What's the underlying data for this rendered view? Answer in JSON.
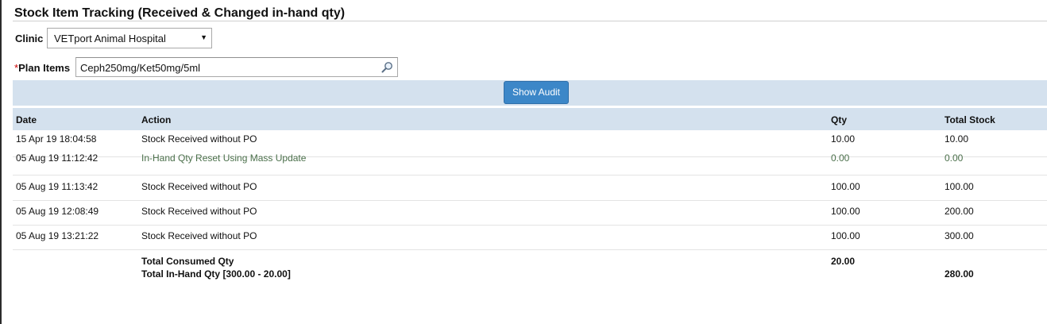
{
  "page": {
    "title": "Stock Item Tracking (Received & Changed in-hand qty)"
  },
  "filters": {
    "clinic_label": "Clinic",
    "clinic_value": "VETport Animal Hospital",
    "required_mark": "*",
    "plan_items_label": "Plan Items",
    "plan_items_value": "Ceph250mg/Ket50mg/5ml"
  },
  "actions": {
    "show_audit_label": "Show Audit"
  },
  "table": {
    "headers": {
      "date": "Date",
      "action": "Action",
      "qty": "Qty",
      "total_stock": "Total Stock"
    },
    "rows": [
      {
        "date": "15 Apr 19 18:04:58",
        "action": "Stock Received without PO",
        "qty": "10.00",
        "total": "10.00"
      },
      {
        "date": "05 Aug 19 11:12:42",
        "action": "In-Hand Qty Reset Using Mass Update",
        "qty": "0.00",
        "total": "0.00"
      },
      {
        "date": "05 Aug 19 11:13:42",
        "action": "Stock Received without PO",
        "qty": "100.00",
        "total": "100.00"
      },
      {
        "date": "05 Aug 19 12:08:49",
        "action": "Stock Received without PO",
        "qty": "100.00",
        "total": "200.00"
      },
      {
        "date": "05 Aug 19 13:21:22",
        "action": "Stock Received without PO",
        "qty": "100.00",
        "total": "300.00"
      }
    ],
    "summary": {
      "consumed_label": "Total Consumed Qty",
      "consumed_qty": "20.00",
      "inhand_label": "Total In-Hand Qty [300.00 - 20.00]",
      "inhand_total": "280.00"
    }
  },
  "icons": {
    "search": "magnifier-icon",
    "dropdown": "triangle-down"
  },
  "colors": {
    "accent": "#3c87c8",
    "bar_bg": "#d4e1ee",
    "highlight_text": "#4a6f4a"
  }
}
